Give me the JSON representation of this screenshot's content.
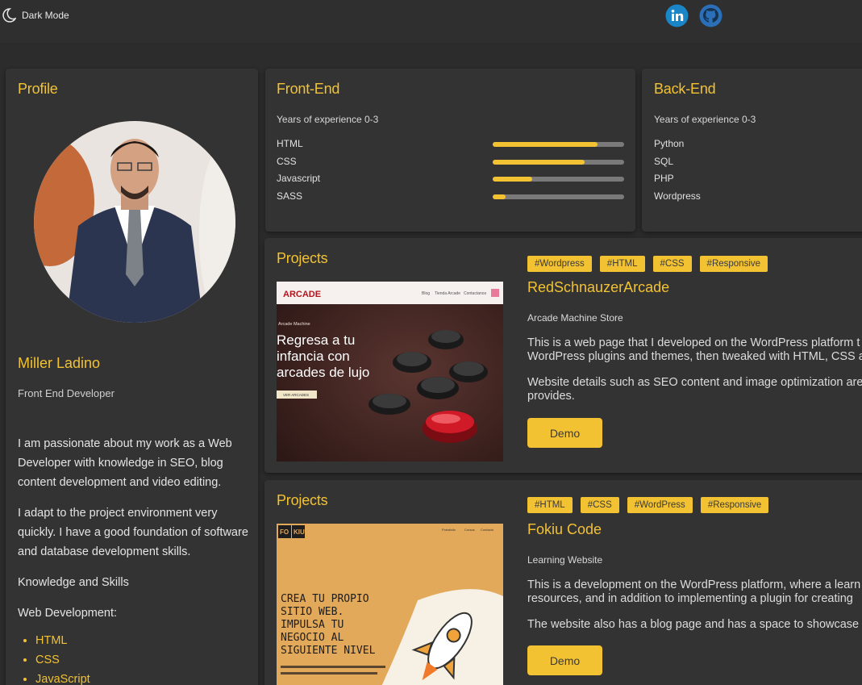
{
  "header": {
    "dark_mode_label": "Dark Mode",
    "social_icons": [
      "linkedin-icon",
      "github-icon"
    ]
  },
  "colors": {
    "accent": "#f2c233",
    "background": "#2c2c2c",
    "card": "#333333"
  },
  "profile": {
    "title": "Profile",
    "name": "Miller Ladino",
    "role": "Front End Developer",
    "bio": [
      "I am passionate about my work as a Web Developer with knowledge in SEO, blog content development and video editing.",
      "I adapt to the project environment very quickly. I have a good foundation of software and database development skills.",
      "Knowledge and Skills",
      "Web Development:"
    ],
    "skills_list": [
      "HTML",
      "CSS",
      "JavaScript"
    ]
  },
  "frontend": {
    "title": "Front-End",
    "experience": "Years of experience 0-3",
    "skills": [
      {
        "name": "HTML",
        "level": 0.8
      },
      {
        "name": "CSS",
        "level": 0.7
      },
      {
        "name": "Javascript",
        "level": 0.3
      },
      {
        "name": "SASS",
        "level": 0.1
      }
    ]
  },
  "backend": {
    "title": "Back-End",
    "experience": "Years of experience 0-3",
    "skills": [
      "Python",
      "SQL",
      "PHP",
      "Wordpress"
    ]
  },
  "projects": [
    {
      "section_title": "Projects",
      "tags": [
        "#Wordpress",
        "#HTML",
        "#CSS",
        "#Responsive"
      ],
      "title": "RedSchnauzerArcade",
      "subtitle": "Arcade Machine Store",
      "desc": [
        "This is a web page that I developed on the WordPress platform t",
        "WordPress plugins and themes, then tweaked with HTML, CSS a",
        "Website details such as SEO content and image optimization are",
        "provides."
      ],
      "demo_label": "Demo",
      "thumb": {
        "nav": [
          "Blog",
          "Tienda Arcade",
          "Contactanos"
        ],
        "kicker": "Arcade Machine",
        "headline": [
          "Regresa a tu",
          "infancia con",
          "arcades de lujo"
        ],
        "cta": "VER ARCADES"
      }
    },
    {
      "section_title": "Projects",
      "tags": [
        "#HTML",
        "#CSS",
        "#WordPress",
        "#Responsive"
      ],
      "title": "Fokiu Code",
      "subtitle": "Learning Website",
      "desc": [
        "This is a development on the WordPress platform, where a learn",
        "resources, and in addition to implementing a plugin for creating",
        "The website also has a blog page and has a space to showcase"
      ],
      "demo_label": "Demo",
      "thumb": {
        "nav": [
          "Portafolio",
          "Cursos",
          "Contacto"
        ],
        "headline": [
          "CREA TU PROPIO",
          "SITIO WEB.",
          "IMPULSA TU",
          "NEGOCIO AL",
          "SIGUIENTE NIVEL"
        ]
      }
    }
  ]
}
